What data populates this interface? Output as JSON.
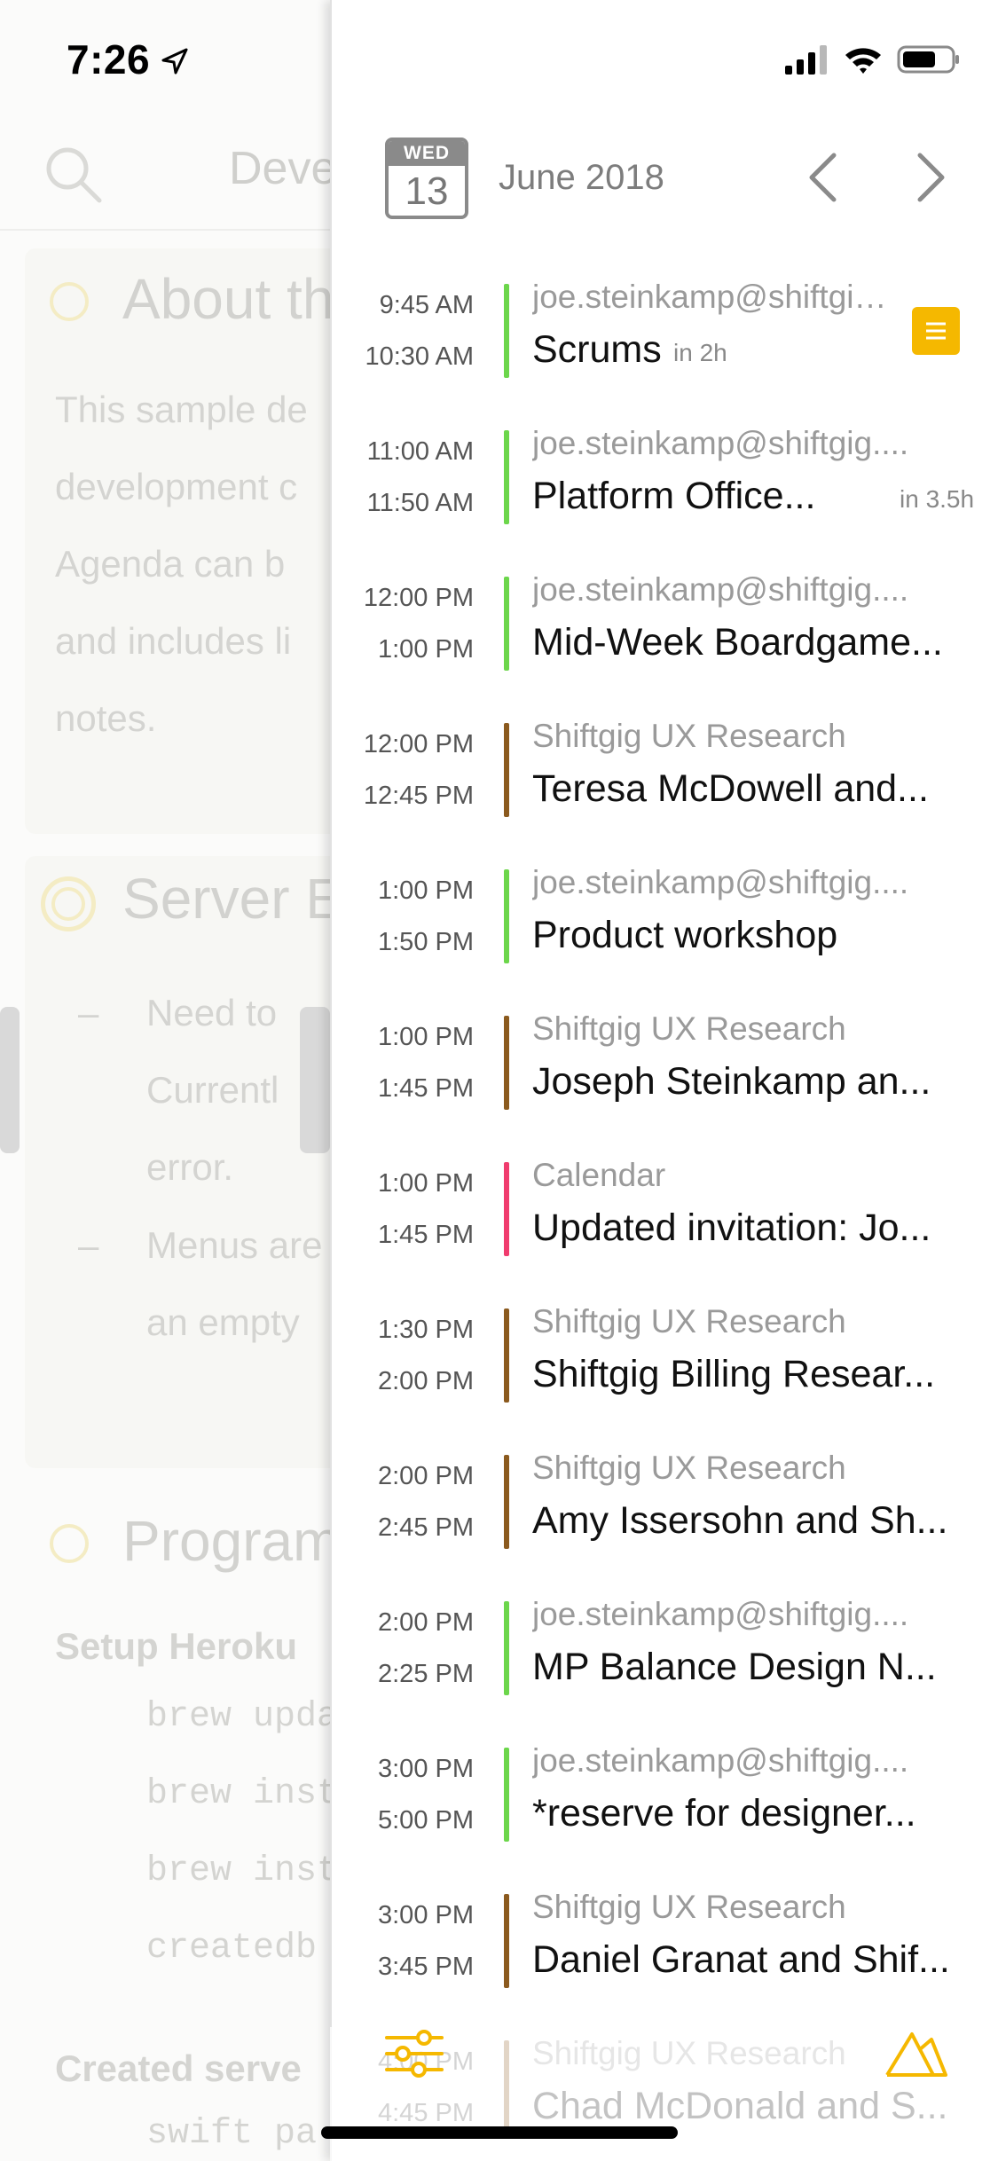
{
  "status_bar": {
    "time": "7:26"
  },
  "background_note": {
    "header_title": "Deve",
    "sections": [
      {
        "title": "About th",
        "lines": [
          "This sample de",
          "development c",
          "Agenda can b",
          "and includes li",
          "notes."
        ]
      },
      {
        "title": "Server E",
        "items": [
          [
            "Need to",
            "Currentl",
            "error."
          ],
          [
            "Menus are",
            "an empty"
          ]
        ]
      },
      {
        "title": "Program"
      }
    ],
    "setup_heading": "Setup Heroku",
    "code_lines": [
      "brew upda",
      "brew inst",
      "brew inst",
      "createdb"
    ],
    "created_heading": "Created serve",
    "last_code": "swift pa"
  },
  "agenda": {
    "day_of_week": "WED",
    "day_number": "13",
    "month": "June 2018",
    "events": [
      {
        "start": "9:45 AM",
        "end": "10:30 AM",
        "calendar": "joe.steinkamp@shiftgig....",
        "title": "Scrums",
        "relative": "in 2h",
        "color": "#6cd64b",
        "has_note": true
      },
      {
        "start": "11:00 AM",
        "end": "11:50 AM",
        "calendar": "joe.steinkamp@shiftgig....",
        "title": "Platform Office...",
        "relative": "in 3.5h",
        "color": "#6cd64b"
      },
      {
        "start": "12:00 PM",
        "end": "1:00 PM",
        "calendar": "joe.steinkamp@shiftgig....",
        "title": "Mid-Week Boardgame...",
        "color": "#6cd64b"
      },
      {
        "start": "12:00 PM",
        "end": "12:45 PM",
        "calendar": "Shiftgig UX Research",
        "title": "Teresa McDowell and...",
        "color": "#8b5a1e"
      },
      {
        "start": "1:00 PM",
        "end": "1:50 PM",
        "calendar": "joe.steinkamp@shiftgig....",
        "title": "Product workshop",
        "color": "#6cd64b"
      },
      {
        "start": "1:00 PM",
        "end": "1:45 PM",
        "calendar": "Shiftgig UX Research",
        "title": "Joseph Steinkamp an...",
        "color": "#8b5a1e"
      },
      {
        "start": "1:00 PM",
        "end": "1:45 PM",
        "calendar": "Calendar",
        "title": "Updated invitation: Jo...",
        "color": "#f03c6e"
      },
      {
        "start": "1:30 PM",
        "end": "2:00 PM",
        "calendar": "Shiftgig UX Research",
        "title": "Shiftgig Billing Resear...",
        "color": "#8b5a1e"
      },
      {
        "start": "2:00 PM",
        "end": "2:45 PM",
        "calendar": "Shiftgig UX Research",
        "title": "Amy Issersohn and Sh...",
        "color": "#8b5a1e"
      },
      {
        "start": "2:00 PM",
        "end": "2:25 PM",
        "calendar": "joe.steinkamp@shiftgig....",
        "title": "MP Balance Design N...",
        "color": "#6cd64b"
      },
      {
        "start": "3:00 PM",
        "end": "5:00 PM",
        "calendar": "joe.steinkamp@shiftgig....",
        "title": "*reserve for designer...",
        "color": "#6cd64b"
      },
      {
        "start": "3:00 PM",
        "end": "3:45 PM",
        "calendar": "Shiftgig UX Research",
        "title": "Daniel Granat and Shif...",
        "color": "#8b5a1e"
      },
      {
        "start": "4:00 PM",
        "end": "4:45 PM",
        "calendar": "Shiftgig UX Research",
        "title": "Chad McDonald and S...",
        "color": "#8b5a1e"
      }
    ]
  },
  "accent_color": "#f5b800"
}
